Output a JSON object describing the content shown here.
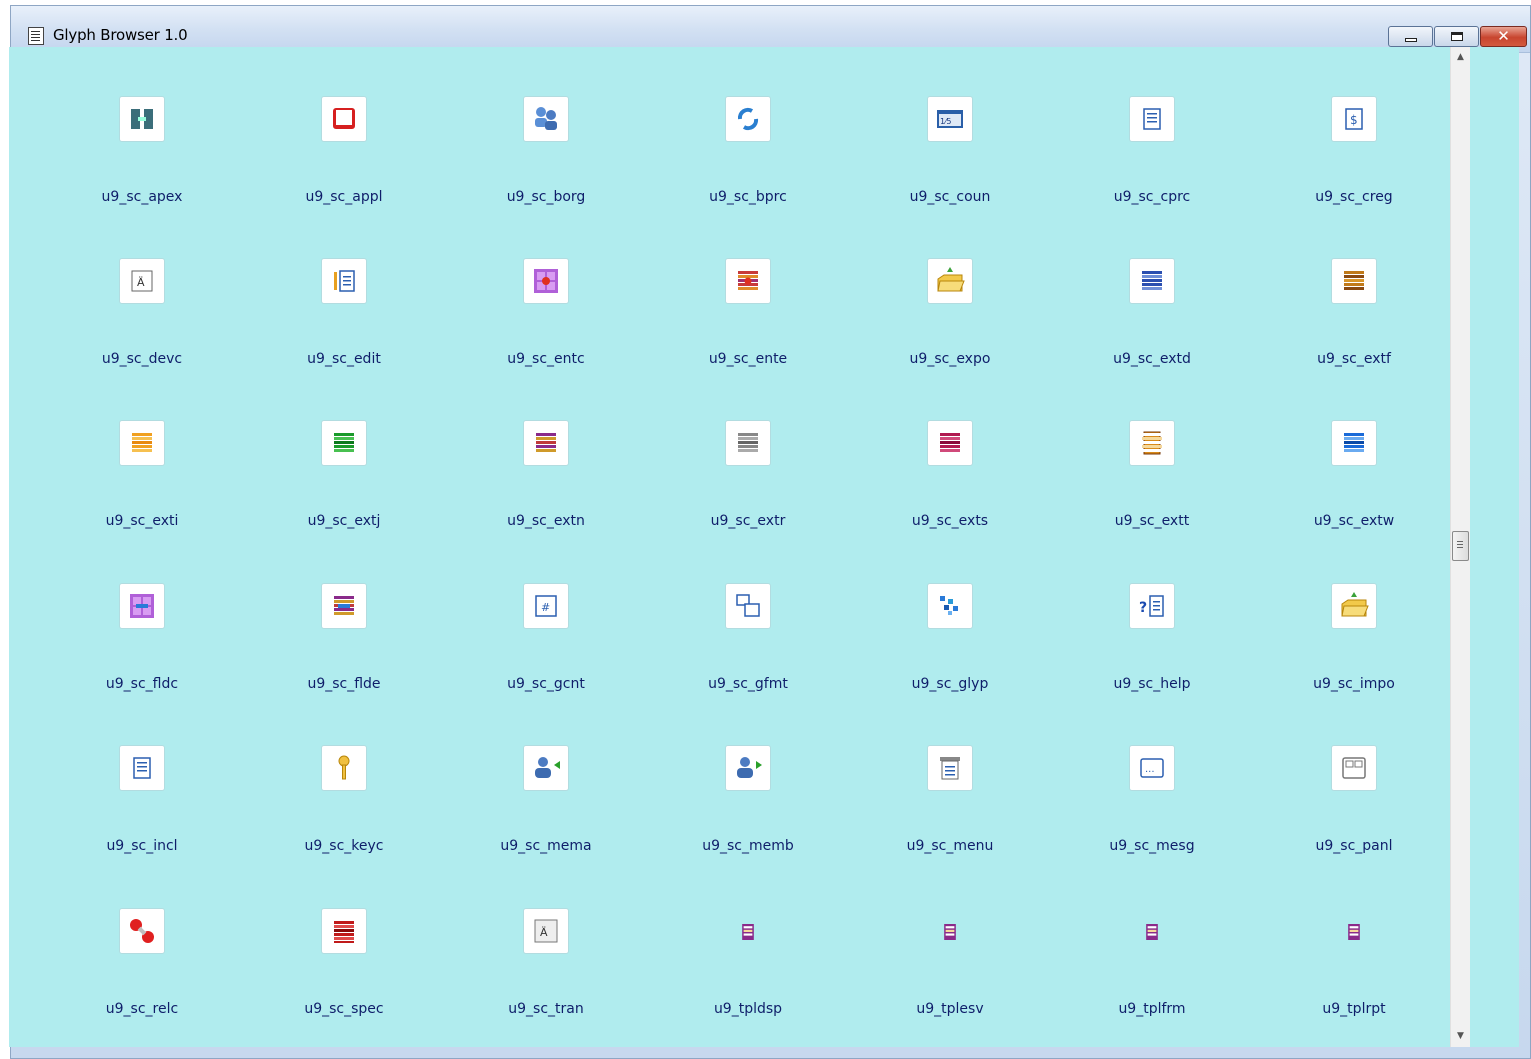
{
  "window": {
    "title": "Glyph Browser 1.0",
    "controls": {
      "minimize": "–",
      "maximize": "□",
      "close": "✕"
    }
  },
  "colors": {
    "client_background": "#b0ecee",
    "label_text": "#0f1e6a"
  },
  "glyphs": [
    [
      "u9_sc_apex",
      "u9_sc_appl",
      "u9_sc_borg",
      "u9_sc_bprc",
      "u9_sc_coun",
      "u9_sc_cprc",
      "u9_sc_creg"
    ],
    [
      "u9_sc_devc",
      "u9_sc_edit",
      "u9_sc_entc",
      "u9_sc_ente",
      "u9_sc_expo",
      "u9_sc_extd",
      "u9_sc_extf"
    ],
    [
      "u9_sc_exti",
      "u9_sc_extj",
      "u9_sc_extn",
      "u9_sc_extr",
      "u9_sc_exts",
      "u9_sc_extt",
      "u9_sc_extw"
    ],
    [
      "u9_sc_fldc",
      "u9_sc_flde",
      "u9_sc_gcnt",
      "u9_sc_gfmt",
      "u9_sc_glyp",
      "u9_sc_help",
      "u9_sc_impo"
    ],
    [
      "u9_sc_incl",
      "u9_sc_keyc",
      "u9_sc_mema",
      "u9_sc_memb",
      "u9_sc_menu",
      "u9_sc_mesg",
      "u9_sc_panl"
    ],
    [
      "u9_sc_relc",
      "u9_sc_spec",
      "u9_sc_tran",
      "u9_tpldsp",
      "u9_tplesv",
      "u9_tplfrm",
      "u9_tplrpt"
    ]
  ]
}
